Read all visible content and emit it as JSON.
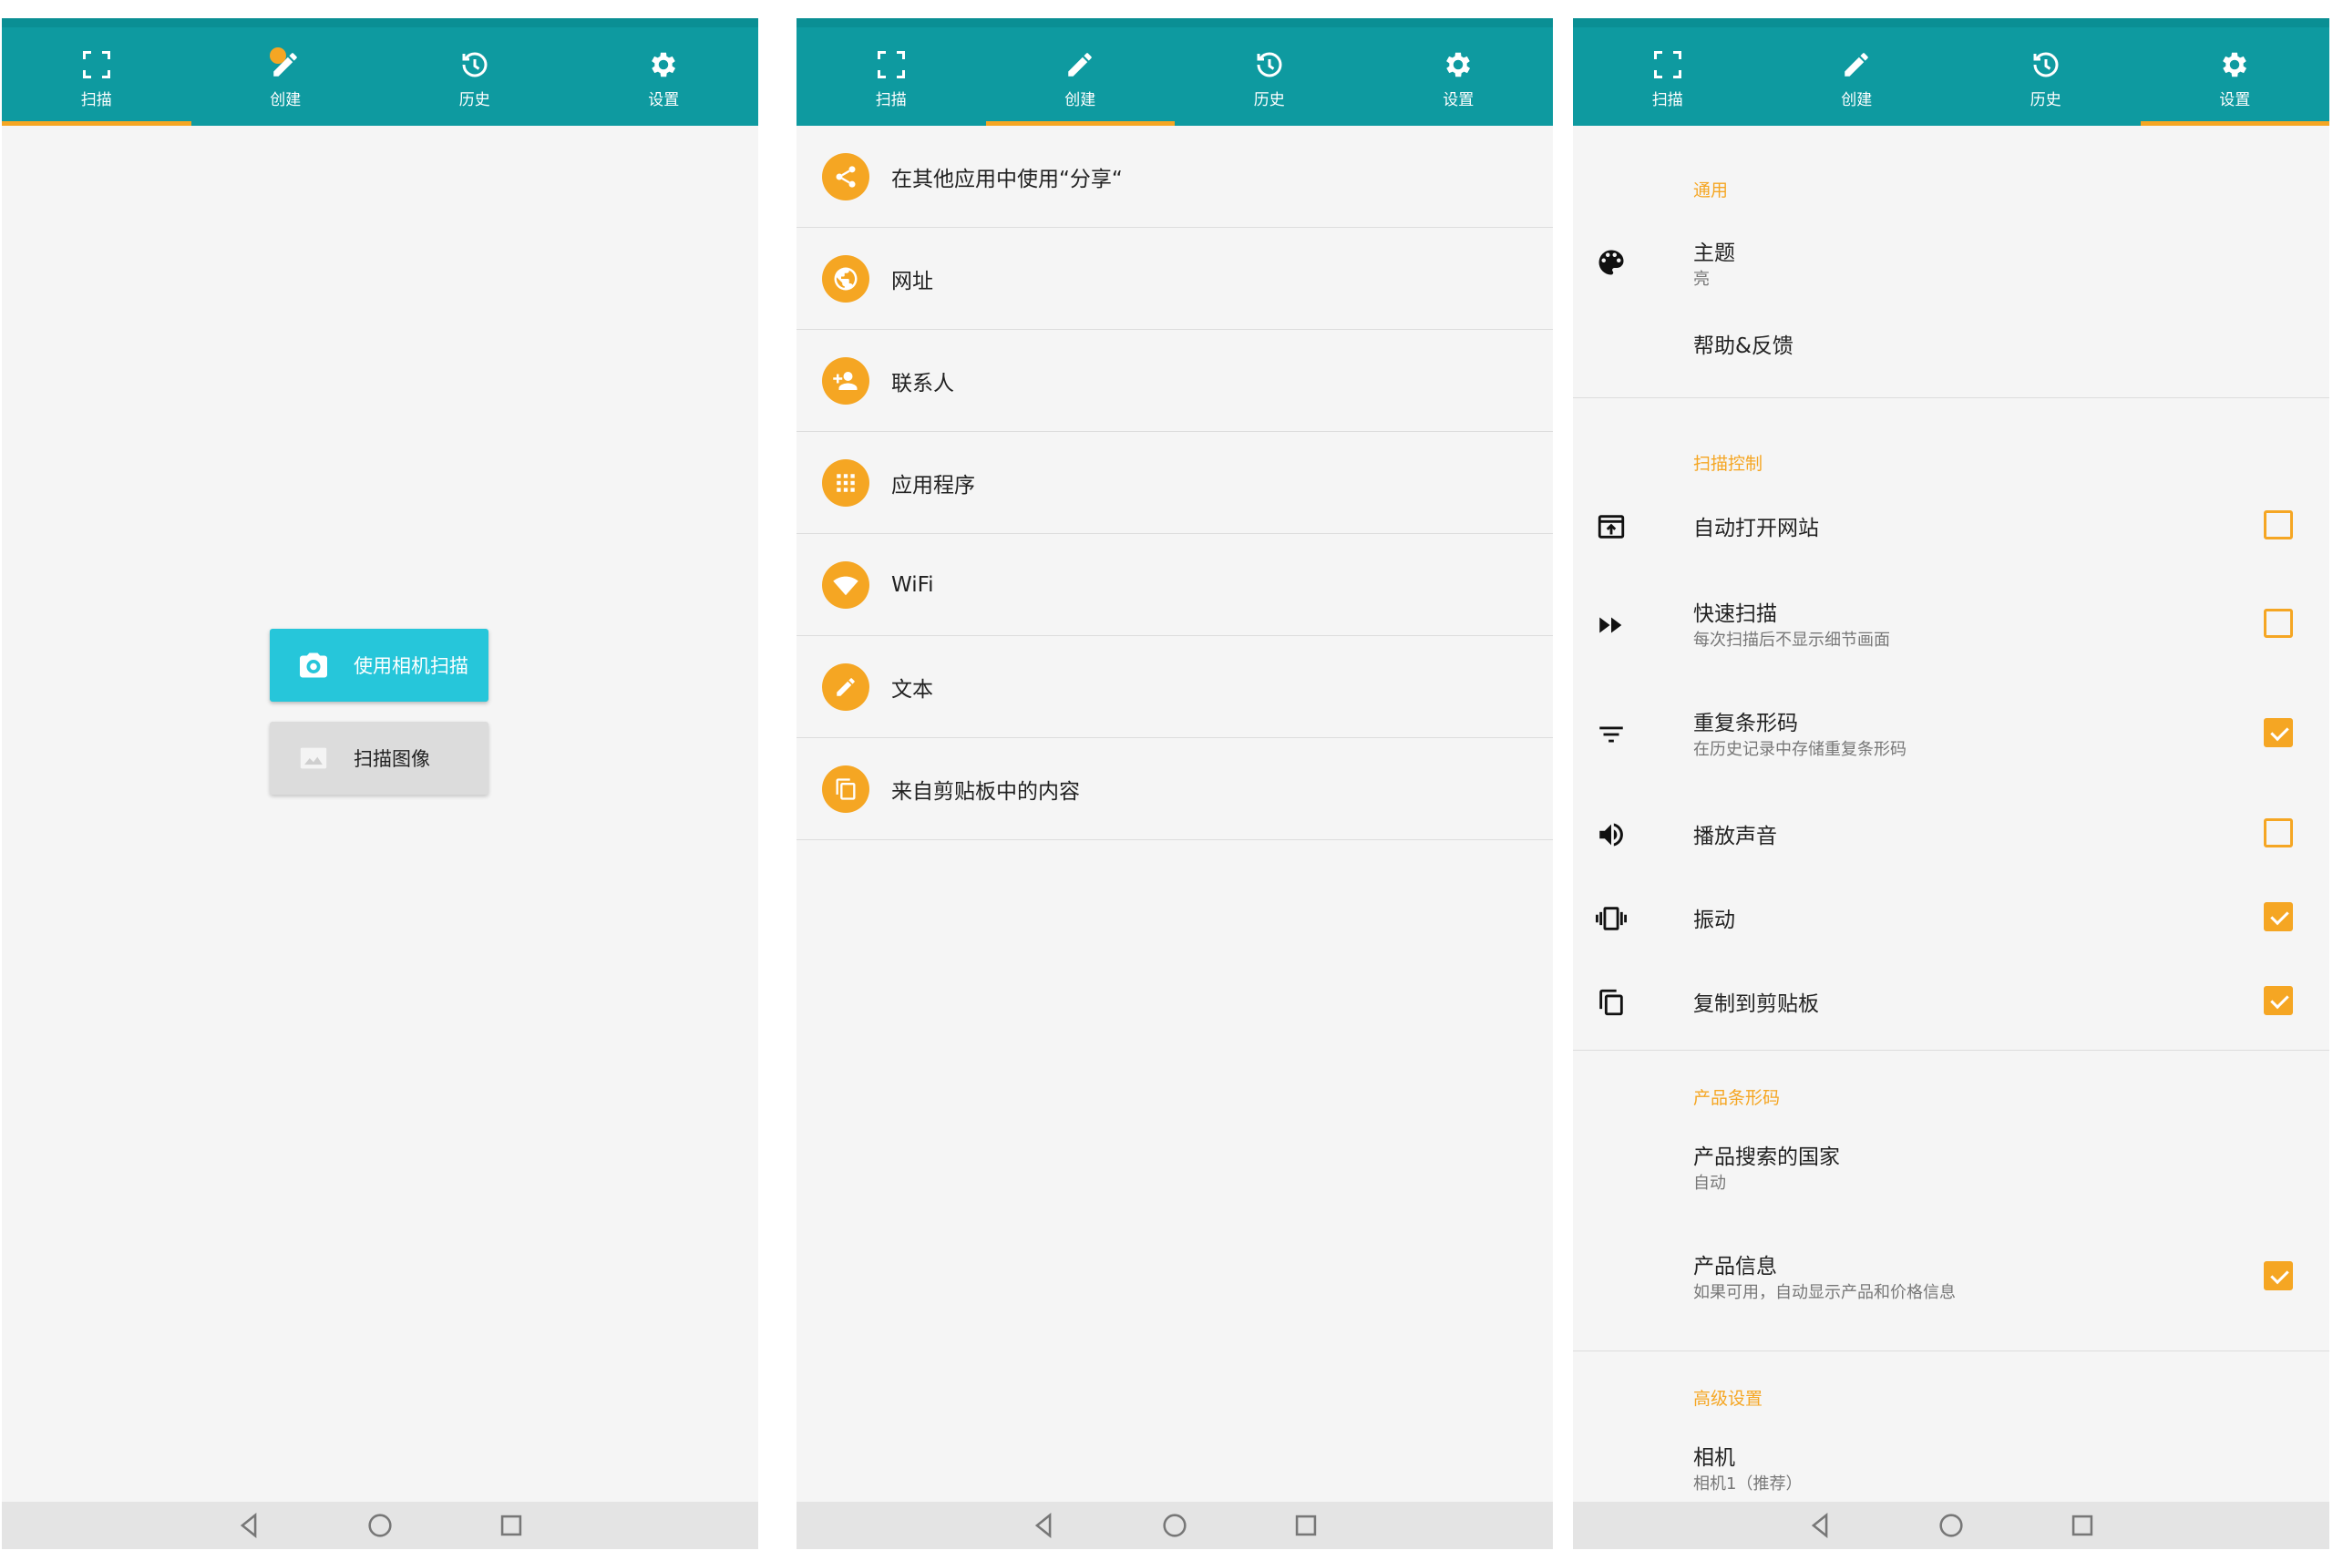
{
  "tabs": [
    {
      "label": "扫描",
      "icon": "scan-frame-icon"
    },
    {
      "label": "创建",
      "icon": "pencil-icon"
    },
    {
      "label": "历史",
      "icon": "history-icon"
    },
    {
      "label": "设置",
      "icon": "gear-icon"
    }
  ],
  "colors": {
    "primary": "#0e9aa0",
    "accent": "#f5a623",
    "button": "#26c6da"
  },
  "scan_screen": {
    "active_tab": "扫描",
    "camera_button": "使用相机扫描",
    "image_button": "扫描图像"
  },
  "create_screen": {
    "active_tab": "创建",
    "items": [
      {
        "label": "在其他应用中使用“分享“",
        "icon": "share-icon"
      },
      {
        "label": "网址",
        "icon": "globe-icon"
      },
      {
        "label": "联系人",
        "icon": "contact-add-icon"
      },
      {
        "label": "应用程序",
        "icon": "apps-grid-icon"
      },
      {
        "label": "WiFi",
        "icon": "wifi-icon"
      },
      {
        "label": "文本",
        "icon": "pencil-icon"
      },
      {
        "label": "来自剪贴板中的内容",
        "icon": "clipboard-icon"
      }
    ]
  },
  "settings_screen": {
    "active_tab": "设置",
    "sections": {
      "general": "通用",
      "scan_control": "扫描控制",
      "product_barcode": "产品条形码",
      "advanced": "高级设置"
    },
    "theme": {
      "title": "主题",
      "value": "亮"
    },
    "help": "帮助&反馈",
    "auto_open": {
      "title": "自动打开网站",
      "checked": false
    },
    "fast_scan": {
      "title": "快速扫描",
      "sub": "每次扫描后不显示细节画面",
      "checked": false
    },
    "duplicate": {
      "title": "重复条形码",
      "sub": "在历史记录中存储重复条形码",
      "checked": true
    },
    "sound": {
      "title": "播放声音",
      "checked": false
    },
    "vibrate": {
      "title": "振动",
      "checked": true
    },
    "copy": {
      "title": "复制到剪贴板",
      "checked": true
    },
    "country": {
      "title": "产品搜索的国家",
      "value": "自动"
    },
    "product_info": {
      "title": "产品信息",
      "sub": "如果可用，自动显示产品和价格信息",
      "checked": true
    },
    "camera": {
      "title": "相机",
      "value": "相机1（推荐）"
    }
  }
}
